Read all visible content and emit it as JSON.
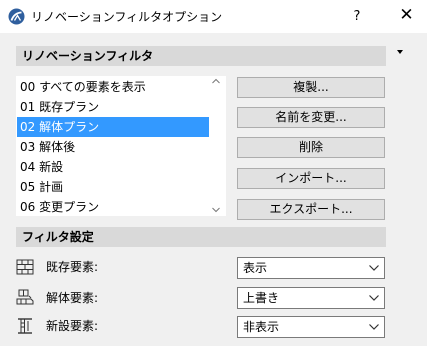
{
  "window": {
    "title": "リノベーションフィルタオプション",
    "help_label": "?",
    "close_label": "✕"
  },
  "filter_section": {
    "header": "リノベーションフィルタ",
    "items": [
      {
        "label": "00 すべての要素を表示"
      },
      {
        "label": "01 既存プラン"
      },
      {
        "label": "02 解体プラン",
        "selected": true
      },
      {
        "label": "03 解体後"
      },
      {
        "label": "04 新設"
      },
      {
        "label": "05 計画"
      },
      {
        "label": "06 変更プラン"
      }
    ],
    "buttons": {
      "duplicate": "複製...",
      "rename": "名前を変更...",
      "delete": "削除",
      "import": "インポート...",
      "export": "エクスポート..."
    }
  },
  "settings_section": {
    "header": "フィルタ設定",
    "rows": [
      {
        "label": "既存要素:",
        "value": "表示",
        "icon": "existing-element-icon"
      },
      {
        "label": "解体要素:",
        "value": "上書き",
        "icon": "demolished-element-icon"
      },
      {
        "label": "新設要素:",
        "value": "非表示",
        "icon": "new-element-icon"
      }
    ]
  }
}
